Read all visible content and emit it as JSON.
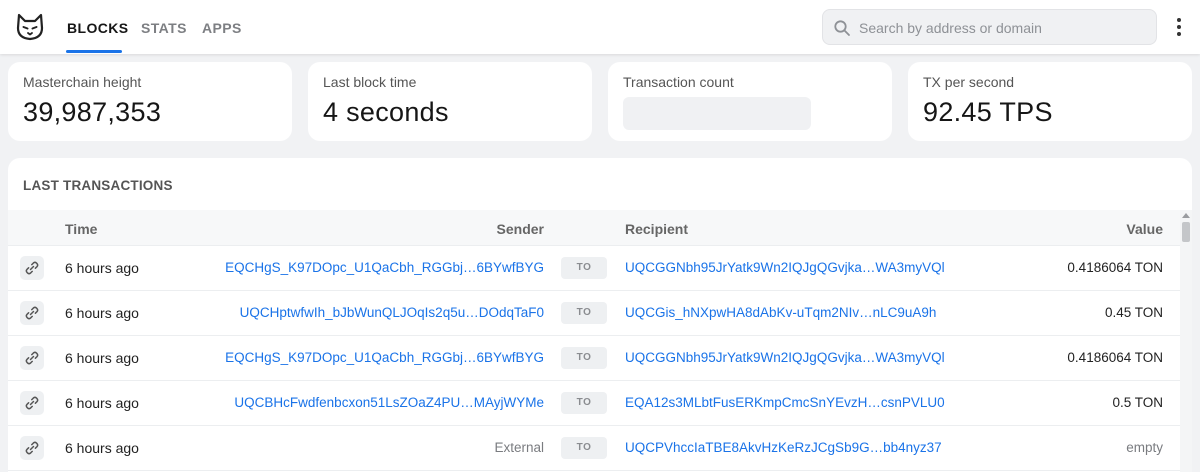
{
  "header": {
    "logo_icon": "cat-face-icon",
    "tabs": [
      {
        "label": "BLOCKS",
        "active": true
      },
      {
        "label": "STATS",
        "active": false
      },
      {
        "label": "APPS",
        "active": false
      }
    ],
    "search": {
      "placeholder": "Search by address or domain",
      "value": "",
      "icon": "search-icon"
    },
    "menu_icon": "more-vertical-icon",
    "accent_color": "#1a73e8"
  },
  "stats": [
    {
      "label": "Masterchain height",
      "value": "39,987,353"
    },
    {
      "label": "Last block time",
      "value": "4 seconds"
    },
    {
      "label": "Transaction count",
      "value": null,
      "loading": true
    },
    {
      "label": "TX per second",
      "value": "92.45 TPS"
    }
  ],
  "transactions": {
    "title": "LAST TRANSACTIONS",
    "columns": {
      "time": "Time",
      "sender": "Sender",
      "recipient": "Recipient",
      "value": "Value"
    },
    "to_label": "TO",
    "link_icon": "link-icon",
    "rows": [
      {
        "time": "6 hours ago",
        "sender": "EQCHgS_K97DOpc_U1QaCbh_RGGbj…6BYwfBYG",
        "sender_external": false,
        "recipient": "UQCGGNbh95JrYatk9Wn2IQJgQGvjka…WA3myVQl",
        "value": "0.4186064 TON"
      },
      {
        "time": "6 hours ago",
        "sender": "UQCHptwfwIh_bJbWunQLJOqIs2q5u…DOdqTaF0",
        "sender_external": false,
        "recipient": "UQCGis_hNXpwHA8dAbKv-uTqm2NIv…nLC9uA9h",
        "value": "0.45 TON"
      },
      {
        "time": "6 hours ago",
        "sender": "EQCHgS_K97DOpc_U1QaCbh_RGGbj…6BYwfBYG",
        "sender_external": false,
        "recipient": "UQCGGNbh95JrYatk9Wn2IQJgQGvjka…WA3myVQl",
        "value": "0.4186064 TON"
      },
      {
        "time": "6 hours ago",
        "sender": "UQCBHcFwdfenbcxon51LsZOaZ4PU…MAyjWYMe",
        "sender_external": false,
        "recipient": "EQA12s3MLbtFusERKmpCmcSnYEvzH…csnPVLU0",
        "value": "0.5 TON"
      },
      {
        "time": "6 hours ago",
        "sender": "External",
        "sender_external": true,
        "recipient": "UQCPVhccIaTBE8AkvHzKeRzJCgSb9G…bb4nyz37",
        "value": "empty"
      }
    ]
  }
}
